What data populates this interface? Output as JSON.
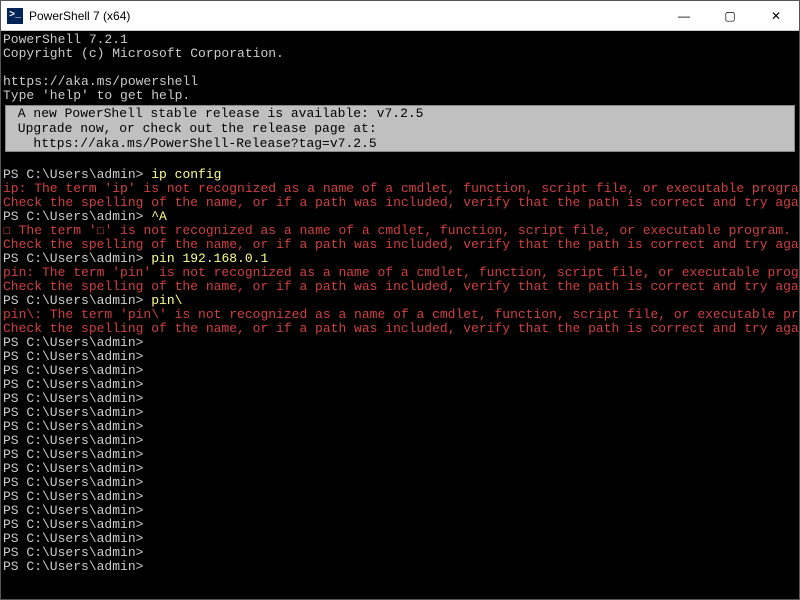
{
  "titlebar": {
    "icon_glyph": ">_",
    "title": "PowerShell 7 (x64)",
    "min": "—",
    "max": "▢",
    "close": "✕"
  },
  "header": {
    "line1": "PowerShell 7.2.1",
    "line2": "Copyright (c) Microsoft Corporation.",
    "url": "https://aka.ms/powershell",
    "help": "Type 'help' to get help."
  },
  "notice": {
    "l1": " A new PowerShell stable release is available: v7.2.5",
    "l2": " Upgrade now, or check out the release page at:",
    "l3": "   https://aka.ms/PowerShell-Release?tag=v7.2.5"
  },
  "p": {
    "prompt": "PS C:\\Users\\admin> ",
    "cmd1": "ip config",
    "err1a": "ip: The term 'ip' is not recognized as a name of a cmdlet, function, script file, or executable program.",
    "err1b": "Check the spelling of the name, or if a path was included, verify that the path is correct and try again.",
    "cmd2": "^A",
    "err2a": "☐ The term '☐' is not recognized as a name of a cmdlet, function, script file, or executable program.",
    "err2b": "Check the spelling of the name, or if a path was included, verify that the path is correct and try again.",
    "cmd3": "pin 192.168.0.1",
    "err3a": "pin: The term 'pin' is not recognized as a name of a cmdlet, function, script file, or executable program.",
    "err3b": "Check the spelling of the name, or if a path was included, verify that the path is correct and try again.",
    "cmd4": "pin\\",
    "err4a": "pin\\: The term 'pin\\' is not recognized as a name of a cmdlet, function, script file, or executable program.",
    "err4b": "Check the spelling of the name, or if a path was included, verify that the path is correct and try again."
  }
}
